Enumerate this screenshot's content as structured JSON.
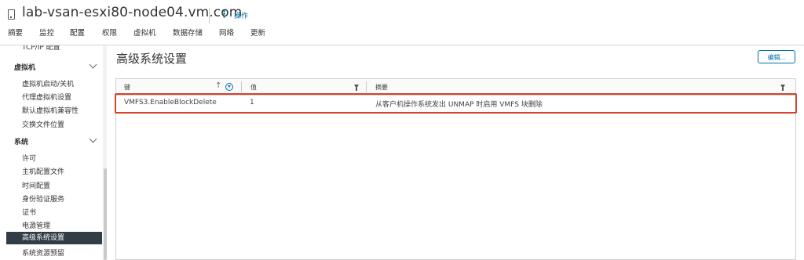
{
  "header": {
    "host_name": "lab-vsan-esxi80-node04.vm.com",
    "actions_label": "操作",
    "tabs": [
      "摘要",
      "监控",
      "配置",
      "权限",
      "虚拟机",
      "数据存储",
      "网络",
      "更新"
    ],
    "active_tab": "配置"
  },
  "sidebar": {
    "partial_item": "TCP/IP 配置",
    "groups": [
      {
        "label": "虚拟机",
        "items": [
          "虚拟机启动/关机",
          "代理虚拟机设置",
          "默认虚拟机兼容性",
          "交换文件位置"
        ]
      },
      {
        "label": "系统",
        "items": [
          "许可",
          "主机配置文件",
          "时间配置",
          "身份验证服务",
          "证书",
          "电源管理",
          "高级系统设置",
          "系统资源预留"
        ]
      }
    ],
    "selected_item": "高级系统设置"
  },
  "main": {
    "title": "高级系统设置",
    "edit_button": "编辑...",
    "table": {
      "columns": [
        "键",
        "值",
        "摘要"
      ],
      "rows": [
        {
          "key": "VMFS3.EnableBlockDelete",
          "value": "1",
          "summary": "从客户机操作系统发出 UNMAP 时启用 VMFS 块删除"
        }
      ]
    }
  },
  "colors": {
    "accent": "#0072a3",
    "selected_bg": "#313c47",
    "highlight_border": "#d6432c"
  }
}
